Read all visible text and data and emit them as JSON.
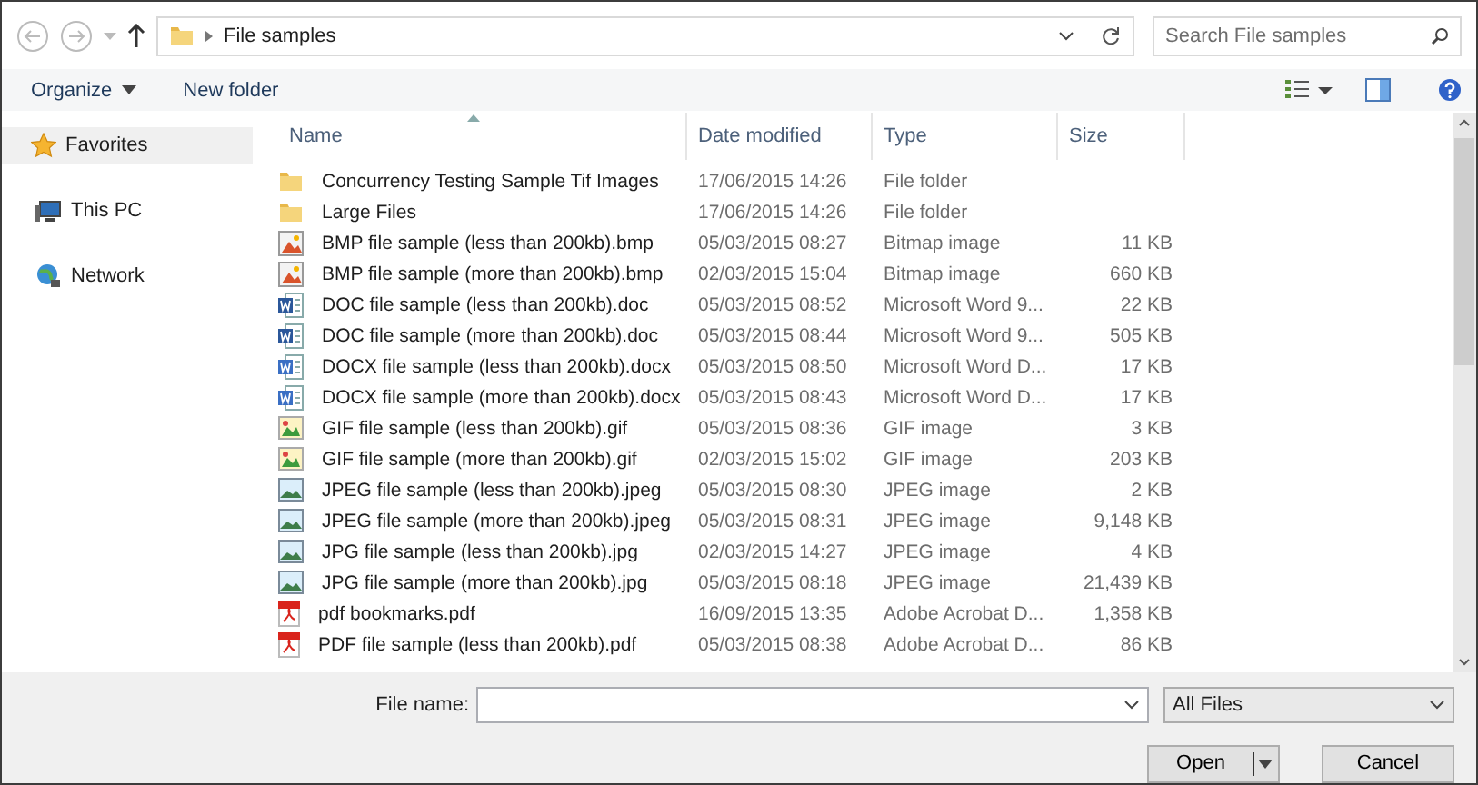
{
  "address": {
    "crumbs": [
      "File samples"
    ]
  },
  "search": {
    "placeholder": "Search File samples"
  },
  "toolbar": {
    "buttons": [
      {
        "label": "Organize",
        "menu": true
      },
      {
        "label": "New folder",
        "menu": false
      }
    ]
  },
  "sidebar": {
    "items": [
      {
        "label": "Favorites",
        "kind": "star",
        "selected": true
      },
      {
        "label": "This PC",
        "kind": "pc",
        "selected": false
      },
      {
        "label": "Network",
        "kind": "network",
        "selected": false
      }
    ]
  },
  "table": {
    "columns": [
      "Name",
      "Date modified",
      "Type",
      "Size"
    ],
    "rows": [
      {
        "kind": "folder",
        "name": "Concurrency Testing Sample Tif Images",
        "date": "17/06/2015 14:26",
        "type": "File folder",
        "size": ""
      },
      {
        "kind": "folder",
        "name": "Large Files",
        "date": "17/06/2015 14:26",
        "type": "File folder",
        "size": ""
      },
      {
        "kind": "bitmap",
        "name": "BMP file sample (less than 200kb).bmp",
        "date": "05/03/2015 08:27",
        "type": "Bitmap image",
        "size": "11 KB"
      },
      {
        "kind": "bitmap",
        "name": "BMP file sample (more than 200kb).bmp",
        "date": "02/03/2015 15:04",
        "type": "Bitmap image",
        "size": "660 KB"
      },
      {
        "kind": "word",
        "name": "DOC file sample (less than 200kb).doc",
        "date": "05/03/2015 08:52",
        "type": "Microsoft Word 9...",
        "size": "22 KB"
      },
      {
        "kind": "word",
        "name": "DOC file sample (more than 200kb).doc",
        "date": "05/03/2015 08:44",
        "type": "Microsoft Word 9...",
        "size": "505 KB"
      },
      {
        "kind": "wordx",
        "name": "DOCX file sample (less than 200kb).docx",
        "date": "05/03/2015 08:50",
        "type": "Microsoft Word D...",
        "size": "17 KB"
      },
      {
        "kind": "wordx",
        "name": "DOCX file sample (more than 200kb).docx",
        "date": "05/03/2015 08:43",
        "type": "Microsoft Word D...",
        "size": "17 KB"
      },
      {
        "kind": "gif",
        "name": "GIF file sample (less than 200kb).gif",
        "date": "05/03/2015 08:36",
        "type": "GIF image",
        "size": "3 KB"
      },
      {
        "kind": "gif",
        "name": "GIF file sample (more than 200kb).gif",
        "date": "02/03/2015 15:02",
        "type": "GIF image",
        "size": "203 KB"
      },
      {
        "kind": "jpeg",
        "name": "JPEG file sample (less than 200kb).jpeg",
        "date": "05/03/2015 08:30",
        "type": "JPEG image",
        "size": "2 KB"
      },
      {
        "kind": "jpeg",
        "name": "JPEG file sample (more than 200kb).jpeg",
        "date": "05/03/2015 08:31",
        "type": "JPEG image",
        "size": "9,148 KB"
      },
      {
        "kind": "jpeg",
        "name": "JPG file sample (less than 200kb).jpg",
        "date": "02/03/2015 14:27",
        "type": "JPEG image",
        "size": "4 KB"
      },
      {
        "kind": "jpeg",
        "name": "JPG file sample (more than 200kb).jpg",
        "date": "05/03/2015 08:18",
        "type": "JPEG image",
        "size": "21,439 KB"
      },
      {
        "kind": "pdf",
        "name": "pdf bookmarks.pdf",
        "date": "16/09/2015 13:35",
        "type": "Adobe Acrobat D...",
        "size": "1,358 KB"
      },
      {
        "kind": "pdf",
        "name": "PDF file sample (less than 200kb).pdf",
        "date": "05/03/2015 08:38",
        "type": "Adobe Acrobat D...",
        "size": "86 KB"
      }
    ]
  },
  "footer": {
    "file_name_label": "File name:",
    "filter": "All Files",
    "buttons": [
      {
        "label": "Open",
        "split": true
      },
      {
        "label": "Cancel",
        "split": false
      }
    ]
  }
}
